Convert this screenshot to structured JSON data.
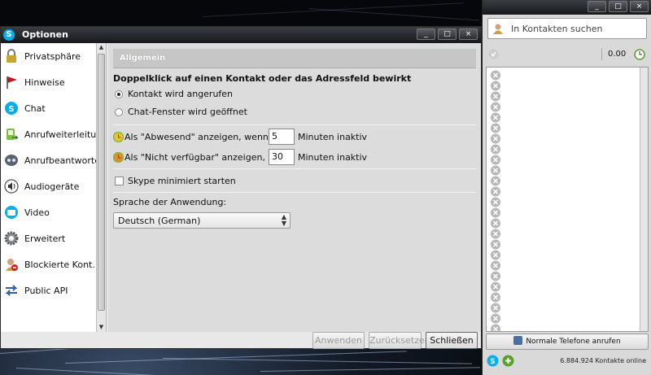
{
  "options_window": {
    "title": "Optionen",
    "window_buttons": [
      "_",
      "□",
      "×"
    ],
    "sidebar": {
      "items": [
        {
          "label": "Privatsphäre",
          "icon": "padlock-icon"
        },
        {
          "label": "Hinweise",
          "icon": "flag-icon"
        },
        {
          "label": "Chat",
          "icon": "chat-icon"
        },
        {
          "label": "Anrufweiterleitung",
          "icon": "call-forwarding-icon"
        },
        {
          "label": "Anrufbeantworter",
          "icon": "voicemail-icon"
        },
        {
          "label": "Audiogeräte",
          "icon": "speaker-icon"
        },
        {
          "label": "Video",
          "icon": "video-icon"
        },
        {
          "label": "Erweitert",
          "icon": "gear-icon"
        },
        {
          "label": "Blockierte Kont...",
          "icon": "blocked-contact-icon"
        },
        {
          "label": "Public API",
          "icon": "api-arrows-icon"
        }
      ]
    },
    "content": {
      "header": "Allgemein",
      "double_click_label": "Doppelklick auf einen Kontakt oder das Adressfeld bewirkt",
      "radio_call": "Kontakt wird angerufen",
      "radio_chat": "Chat-Fenster wird geöffnet",
      "away_label": "Als \"Abwesend\" anzeigen, wenn",
      "away_minutes": "5",
      "away_suffix": "Minuten inaktiv",
      "na_label": "Als \"Nicht verfügbar\" anzeigen, wenn",
      "na_minutes": "30",
      "na_suffix": "Minuten inaktiv",
      "start_minimized": "Skype minimiert starten",
      "start_minimized_checked": false,
      "language_label": "Sprache der Anwendung:",
      "language_value": "Deutsch (German)"
    },
    "buttons": {
      "apply": "Anwenden",
      "reset": "Zurücksetzen",
      "close": "Schließen"
    }
  },
  "skype_window": {
    "search_placeholder": "In Kontakten suchen",
    "balance": "0.00",
    "call_phones": "Normale Telefone anrufen",
    "online_count": "6.884.924 Kontakte online",
    "colors": {
      "skype_blue": "#00aff0",
      "status_grey": "#b8b8b8"
    }
  }
}
